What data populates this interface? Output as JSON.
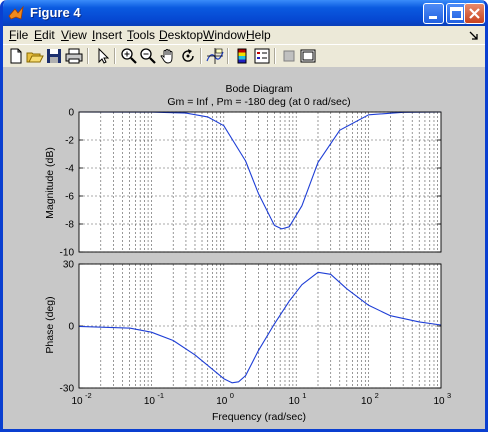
{
  "window": {
    "title": "Figure 4"
  },
  "menu": [
    {
      "label": "File",
      "acc": "F",
      "rest": "ile"
    },
    {
      "label": "Edit",
      "acc": "E",
      "rest": "dit"
    },
    {
      "label": "View",
      "acc": "V",
      "rest": "iew"
    },
    {
      "label": "Insert",
      "acc": "I",
      "rest": "nsert"
    },
    {
      "label": "Tools",
      "acc": "T",
      "rest": "ools"
    },
    {
      "label": "Desktop",
      "acc": "D",
      "rest": "esktop"
    },
    {
      "label": "Window",
      "acc": "W",
      "rest": "indow"
    },
    {
      "label": "Help",
      "acc": "H",
      "rest": "elp"
    }
  ],
  "toolbar": [
    "new-figure-icon",
    "open-file-icon",
    "save-icon",
    "print-icon",
    "edit-plot-arrow-icon",
    "zoom-in-icon",
    "zoom-out-icon",
    "pan-hand-icon",
    "rotate-3d-icon",
    "data-cursor-icon",
    "insert-colorbar-icon",
    "insert-legend-icon",
    "hide-plot-tools-icon",
    "show-plot-tools-icon"
  ],
  "chart_data": {
    "type": "line",
    "title": "Bode Diagram",
    "subtitle": "Gm = Inf ,  Pm = -180 deg (at 0 rad/sec)",
    "xlabel": "Frequency  (rad/sec)",
    "xscale": "log",
    "xlim": [
      0.01,
      1000
    ],
    "x_ticks": [
      "10-2",
      "10-1",
      "100",
      "101",
      "102",
      "103"
    ],
    "grid": true,
    "line_color": "#1f3fd6",
    "magnitude": {
      "ylabel": "Magnitude (dB)",
      "ylim": [
        -10,
        0
      ],
      "y_ticks": [
        "0",
        "-2",
        "-4",
        "-6",
        "-8",
        "-10"
      ],
      "x": [
        0.01,
        0.1,
        0.3,
        0.6,
        1,
        2,
        3,
        5,
        6.3,
        8,
        12,
        20,
        40,
        100,
        300,
        1000
      ],
      "y": [
        0,
        -0.01,
        -0.08,
        -0.35,
        -0.98,
        -3.5,
        -5.8,
        -8.1,
        -8.35,
        -8.2,
        -6.7,
        -3.6,
        -1.3,
        -0.2,
        -0.02,
        0
      ]
    },
    "phase": {
      "ylabel": "Phase (deg)",
      "ylim": [
        -30,
        30
      ],
      "y_ticks": [
        "30",
        "0",
        "-30"
      ],
      "x": [
        0.01,
        0.05,
        0.1,
        0.2,
        0.4,
        0.7,
        1,
        1.3,
        1.6,
        2,
        3,
        5,
        8,
        12,
        20,
        30,
        50,
        100,
        200,
        500,
        1000
      ],
      "y": [
        -0.2,
        -1,
        -3,
        -7,
        -14,
        -21,
        -25.5,
        -27.5,
        -27,
        -24,
        -12,
        1,
        12,
        20,
        26,
        25,
        18,
        10,
        5,
        2,
        0.5
      ]
    }
  }
}
